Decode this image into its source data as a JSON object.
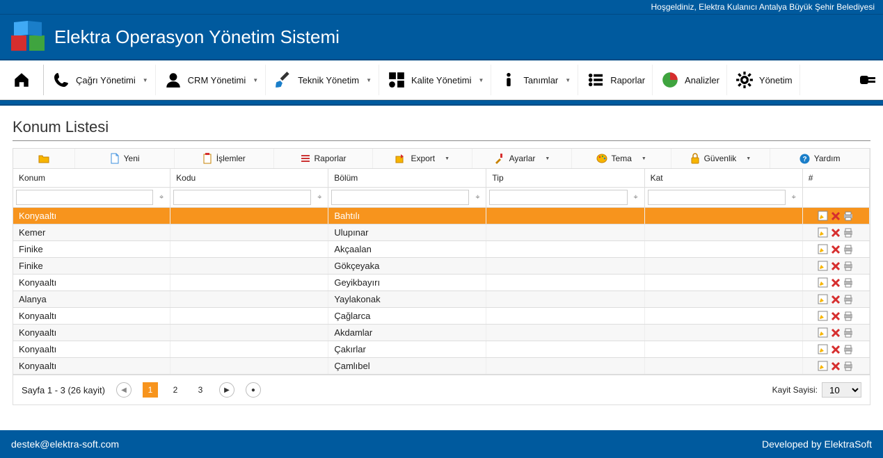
{
  "welcome": "Hoşgeldiniz, Elektra Kulanıcı Antalya Büyük Şehir Belediyesi",
  "brand_title": "Elektra Operasyon Yönetim Sistemi",
  "menu": {
    "cagri": "Çağrı Yönetimi",
    "crm": "CRM Yönetimi",
    "teknik": "Teknik Yönetim",
    "kalite": "Kalite Yönetimi",
    "tanimlar": "Tanımlar",
    "raporlar": "Raporlar",
    "analizler": "Analizler",
    "yonetim": "Yönetim"
  },
  "page_title": "Konum Listesi",
  "toolbar": {
    "yeni": "Yeni",
    "islemler": "İşlemler",
    "raporlar": "Raporlar",
    "export": "Export",
    "ayarlar": "Ayarlar",
    "tema": "Tema",
    "guvenlik": "Güvenlik",
    "yardim": "Yardım"
  },
  "grid": {
    "headers": {
      "konum": "Konum",
      "kodu": "Kodu",
      "bolum": "Bölüm",
      "tip": "Tip",
      "kat": "Kat",
      "act": "#"
    },
    "rows": [
      {
        "konum": "Konyaaltı",
        "kodu": "",
        "bolum": "Bahtılı",
        "tip": "",
        "kat": ""
      },
      {
        "konum": "Kemer",
        "kodu": "",
        "bolum": "Ulupınar",
        "tip": "",
        "kat": ""
      },
      {
        "konum": "Finike",
        "kodu": "",
        "bolum": "Akçaalan",
        "tip": "",
        "kat": ""
      },
      {
        "konum": "Finike",
        "kodu": "",
        "bolum": "Gökçeyaka",
        "tip": "",
        "kat": ""
      },
      {
        "konum": "Konyaaltı",
        "kodu": "",
        "bolum": "Geyikbayırı",
        "tip": "",
        "kat": ""
      },
      {
        "konum": "Alanya",
        "kodu": "",
        "bolum": "Yaylakonak",
        "tip": "",
        "kat": ""
      },
      {
        "konum": "Konyaaltı",
        "kodu": "",
        "bolum": "Çağlarca",
        "tip": "",
        "kat": ""
      },
      {
        "konum": "Konyaaltı",
        "kodu": "",
        "bolum": "Akdamlar",
        "tip": "",
        "kat": ""
      },
      {
        "konum": "Konyaaltı",
        "kodu": "",
        "bolum": "Çakırlar",
        "tip": "",
        "kat": ""
      },
      {
        "konum": "Konyaaltı",
        "kodu": "",
        "bolum": "Çamlıbel",
        "tip": "",
        "kat": ""
      }
    ]
  },
  "pager": {
    "info": "Sayfa 1 - 3 (26 kayit)",
    "pages": [
      "1",
      "2",
      "3"
    ],
    "current": "1",
    "size_label": "Kayit Sayisi:",
    "size_value": "10"
  },
  "footer": {
    "email": "destek@elektra-soft.com",
    "dev": "Developed by ElektraSoft"
  }
}
